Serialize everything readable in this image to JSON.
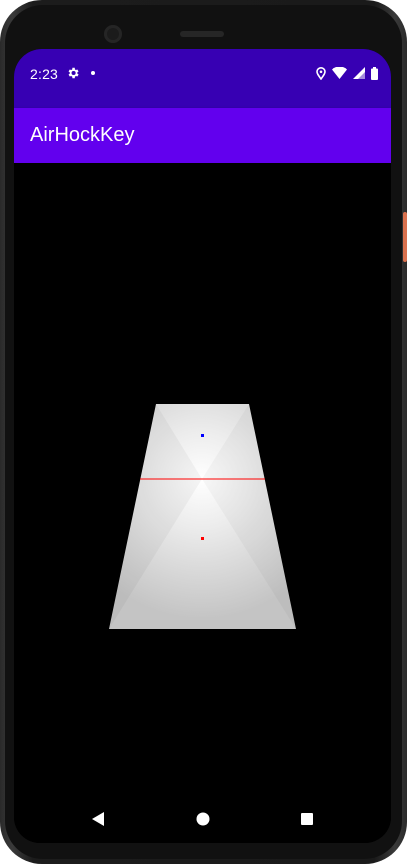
{
  "status_bar": {
    "time": "2:23",
    "left_icons": [
      "gear-icon",
      "notification-dot-icon"
    ],
    "right_icons": [
      "location-icon",
      "wifi-icon",
      "signal-icon",
      "battery-icon"
    ],
    "background": "#3700b3"
  },
  "app_bar": {
    "title": "AirHockKey",
    "background": "#6200ee"
  },
  "game": {
    "table": {
      "shape": "perspective-trapezoid",
      "center_color": "#ffffff",
      "edge_color": "#c6c6c6"
    },
    "center_line_color": "#ff0000",
    "mallets": [
      {
        "name": "top-mallet",
        "color": "#0000ff"
      },
      {
        "name": "bottom-mallet",
        "color": "#ff0000"
      }
    ],
    "background": "#000000"
  },
  "nav_bar": {
    "buttons": [
      "back-icon",
      "home-icon",
      "recents-icon"
    ]
  }
}
